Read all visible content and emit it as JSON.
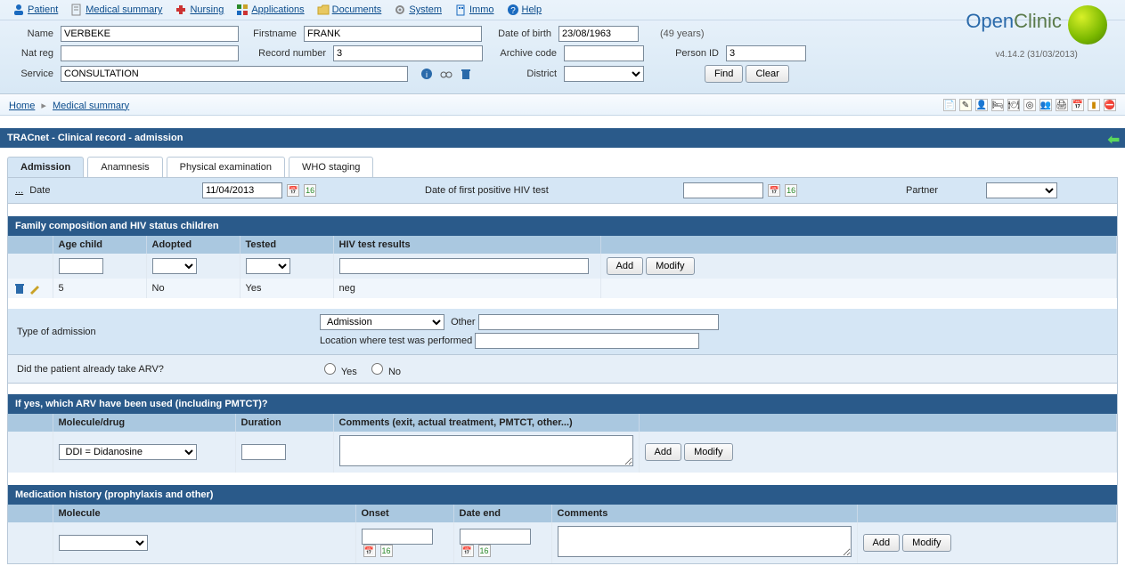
{
  "menu": {
    "items": [
      {
        "label": "Patient",
        "icon": "person-icon",
        "color": "#1a6abf"
      },
      {
        "label": "Medical summary",
        "icon": "document-icon",
        "color": "#999"
      },
      {
        "label": "Nursing",
        "icon": "nurse-icon",
        "color": "#c33"
      },
      {
        "label": "Applications",
        "icon": "apps-icon",
        "color": "#2a8a2a"
      },
      {
        "label": "Documents",
        "icon": "folder-icon",
        "color": "#c9a227"
      },
      {
        "label": "System",
        "icon": "gear-icon",
        "color": "#888"
      },
      {
        "label": "Immo",
        "icon": "building-icon",
        "color": "#1a6abf"
      },
      {
        "label": "Help",
        "icon": "help-icon",
        "color": "#1a6abf"
      }
    ]
  },
  "patient_form": {
    "labels": {
      "name": "Name",
      "firstname": "Firstname",
      "dob": "Date of birth",
      "age": "(49 years)",
      "natreg": "Nat reg",
      "recnum": "Record number",
      "archive": "Archive code",
      "personid": "Person ID",
      "service": "Service",
      "district": "District"
    },
    "values": {
      "name": "VERBEKE",
      "firstname": "FRANK",
      "dob": "23/08/1963",
      "natreg": "",
      "recnum": "3",
      "archive": "",
      "personid": "3",
      "service": "CONSULTATION",
      "district": ""
    },
    "buttons": {
      "find": "Find",
      "clear": "Clear"
    }
  },
  "logo": {
    "brand_pre": "Open",
    "brand_post": "Clinic",
    "version": "v4.14.2 (31/03/2013)"
  },
  "breadcrumb": {
    "home": "Home",
    "current": "Medical summary"
  },
  "page_title": "TRACnet - Clinical record - admission",
  "tabs": [
    {
      "label": "Admission",
      "active": true
    },
    {
      "label": "Anamnesis",
      "active": false
    },
    {
      "label": "Physical examination",
      "active": false
    },
    {
      "label": "WHO staging",
      "active": false
    }
  ],
  "admission_header": {
    "date_label": "Date",
    "date_value": "11/04/2013",
    "first_hiv_label": "Date of first positive HIV test",
    "first_hiv_value": "",
    "partner_label": "Partner",
    "partner_value": ""
  },
  "family_section": {
    "title": "Family composition and HIV status children",
    "headers": {
      "age": "Age child",
      "adopted": "Adopted",
      "tested": "Tested",
      "results": "HIV test results"
    },
    "inputs": {
      "age": "",
      "adopted": "",
      "tested": "",
      "results": ""
    },
    "buttons": {
      "add": "Add",
      "modify": "Modify"
    },
    "rows": [
      {
        "age": "5",
        "adopted": "No",
        "tested": "Yes",
        "results": "neg"
      }
    ]
  },
  "admission_type": {
    "label": "Type of admission",
    "select_value": "Admission",
    "other_label": "Other",
    "other_value": "",
    "location_label": "Location where test was performed",
    "location_value": ""
  },
  "arv_question": {
    "label": "Did the patient already take ARV?",
    "yes_label": "Yes",
    "no_label": "No"
  },
  "arv_section": {
    "title": "If yes, which ARV have been used (including PMTCT)?",
    "headers": {
      "molecule": "Molecule/drug",
      "duration": "Duration",
      "comments": "Comments (exit, actual treatment, PMTCT, other...)"
    },
    "inputs": {
      "molecule": "DDI = Didanosine",
      "duration": "",
      "comments": ""
    },
    "buttons": {
      "add": "Add",
      "modify": "Modify"
    }
  },
  "med_history": {
    "title": "Medication history (prophylaxis and other)",
    "headers": {
      "molecule": "Molecule",
      "onset": "Onset",
      "dateend": "Date end",
      "comments": "Comments"
    },
    "inputs": {
      "molecule": "",
      "onset": "",
      "dateend": "",
      "comments": ""
    },
    "buttons": {
      "add": "Add",
      "modify": "Modify"
    }
  },
  "ellipsis": "..."
}
